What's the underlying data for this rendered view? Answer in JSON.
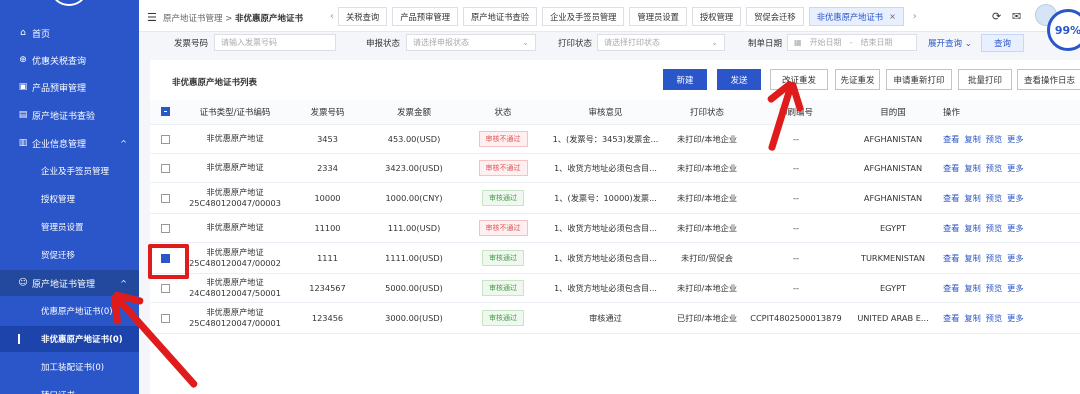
{
  "header": {
    "breadcrumb_parent": "原产地证书管理",
    "breadcrumb_sep": ">",
    "breadcrumb_current": "非优惠原产地证书",
    "tabs": [
      "关税查询",
      "产品预审管理",
      "原产地证书查验",
      "企业及手签员管理",
      "管理员设置",
      "授权管理",
      "贸促会迁移",
      "非优惠原产地证书"
    ],
    "zoom": "99%"
  },
  "sidebar": {
    "items": [
      {
        "label": "首页",
        "icon": "home-icon"
      },
      {
        "label": "优惠关税查询",
        "icon": "search-icon"
      },
      {
        "label": "产品预审管理",
        "icon": "box-icon"
      },
      {
        "label": "原产地证书查验",
        "icon": "certificate-icon"
      },
      {
        "label": "企业信息管理",
        "icon": "building-icon",
        "chevron": "^"
      },
      {
        "label": "企业及手签员管理"
      },
      {
        "label": "授权管理"
      },
      {
        "label": "管理员设置"
      },
      {
        "label": "贸促迁移"
      },
      {
        "label": "原产地证书管理",
        "icon": "user-icon",
        "chevron": "^"
      },
      {
        "label": "优惠原产地证书(0)"
      },
      {
        "label": "非优惠原产地证书(0)"
      },
      {
        "label": "加工装配证书(0)"
      },
      {
        "label": "转口证书"
      }
    ]
  },
  "filter": {
    "invoice_label": "发票号码",
    "invoice_placeholder": "请输入发票号码",
    "apply_label": "申报状态",
    "apply_placeholder": "请选择申报状态",
    "print_label": "打印状态",
    "print_placeholder": "请选择打印状态",
    "date_label": "制单日期",
    "date_start": "开始日期",
    "date_sep": "-",
    "date_end": "结束日期",
    "expand": "展开查询",
    "query": "查询"
  },
  "list": {
    "title": "非优惠原产地证书列表",
    "actions": [
      "新建",
      "发送",
      "改证重发",
      "先证重发",
      "申请重新打印",
      "批量打印",
      "查看操作日志"
    ],
    "columns": [
      "证书类型/证书编码",
      "发票号码",
      "发票金额",
      "状态",
      "审核意见",
      "打印状态",
      "印刷编号",
      "目的国",
      "操作"
    ],
    "ops": [
      "查看",
      "复制",
      "预览",
      "更多"
    ],
    "rows": [
      {
        "type": "非优惠原产地证",
        "code": "",
        "invoice": "3453",
        "amount": "453.00(USD)",
        "status": "审核不通过",
        "status_kind": "fail",
        "opinion": "1、(发票号：3453)发票金...",
        "print": "未打印/本地企业",
        "print_no": "--",
        "country": "AFGHANISTAN",
        "checked": false
      },
      {
        "type": "非优惠原产地证",
        "code": "",
        "invoice": "2334",
        "amount": "3423.00(USD)",
        "status": "审核不通过",
        "status_kind": "fail",
        "opinion": "1、收货方地址必须包含目...",
        "print": "未打印/本地企业",
        "print_no": "--",
        "country": "AFGHANISTAN",
        "checked": false
      },
      {
        "type": "非优惠原产地证",
        "code": "25C480120047/00003",
        "invoice": "10000",
        "amount": "1000.00(CNY)",
        "status": "审核通过",
        "status_kind": "pass",
        "opinion": "1、(发票号：10000)发票...",
        "print": "未打印/本地企业",
        "print_no": "--",
        "country": "AFGHANISTAN",
        "checked": false
      },
      {
        "type": "非优惠原产地证",
        "code": "",
        "invoice": "11100",
        "amount": "111.00(USD)",
        "status": "审核不通过",
        "status_kind": "fail",
        "opinion": "1、收货方地址必须包含目...",
        "print": "未打印/本地企业",
        "print_no": "--",
        "country": "EGYPT",
        "checked": false
      },
      {
        "type": "非优惠原产地证",
        "code": "25C480120047/00002",
        "invoice": "1111",
        "amount": "1111.00(USD)",
        "status": "审核通过",
        "status_kind": "pass",
        "opinion": "1、收货方地址必须包含目...",
        "print": "未打印/贸促会",
        "print_no": "--",
        "country": "TURKMENISTAN",
        "checked": true
      },
      {
        "type": "非优惠原产地证",
        "code": "24C480120047/50001",
        "invoice": "1234567",
        "amount": "5000.00(USD)",
        "status": "审核通过",
        "status_kind": "pass",
        "opinion": "1、收货方地址必须包含目...",
        "print": "未打印/本地企业",
        "print_no": "--",
        "country": "EGYPT",
        "checked": false
      },
      {
        "type": "非优惠原产地证",
        "code": "25C480120047/00001",
        "invoice": "123456",
        "amount": "3000.00(USD)",
        "status": "审核通过",
        "status_kind": "pass",
        "opinion": "审核通过",
        "print": "已打印/本地企业",
        "print_no": "CCPIT4802500013879",
        "country": "UNITED ARAB E...",
        "checked": false
      }
    ]
  },
  "colors": {
    "sidebar": "#2a56c9",
    "primary": "#2a56c9",
    "annotation": "#e01b1b"
  }
}
